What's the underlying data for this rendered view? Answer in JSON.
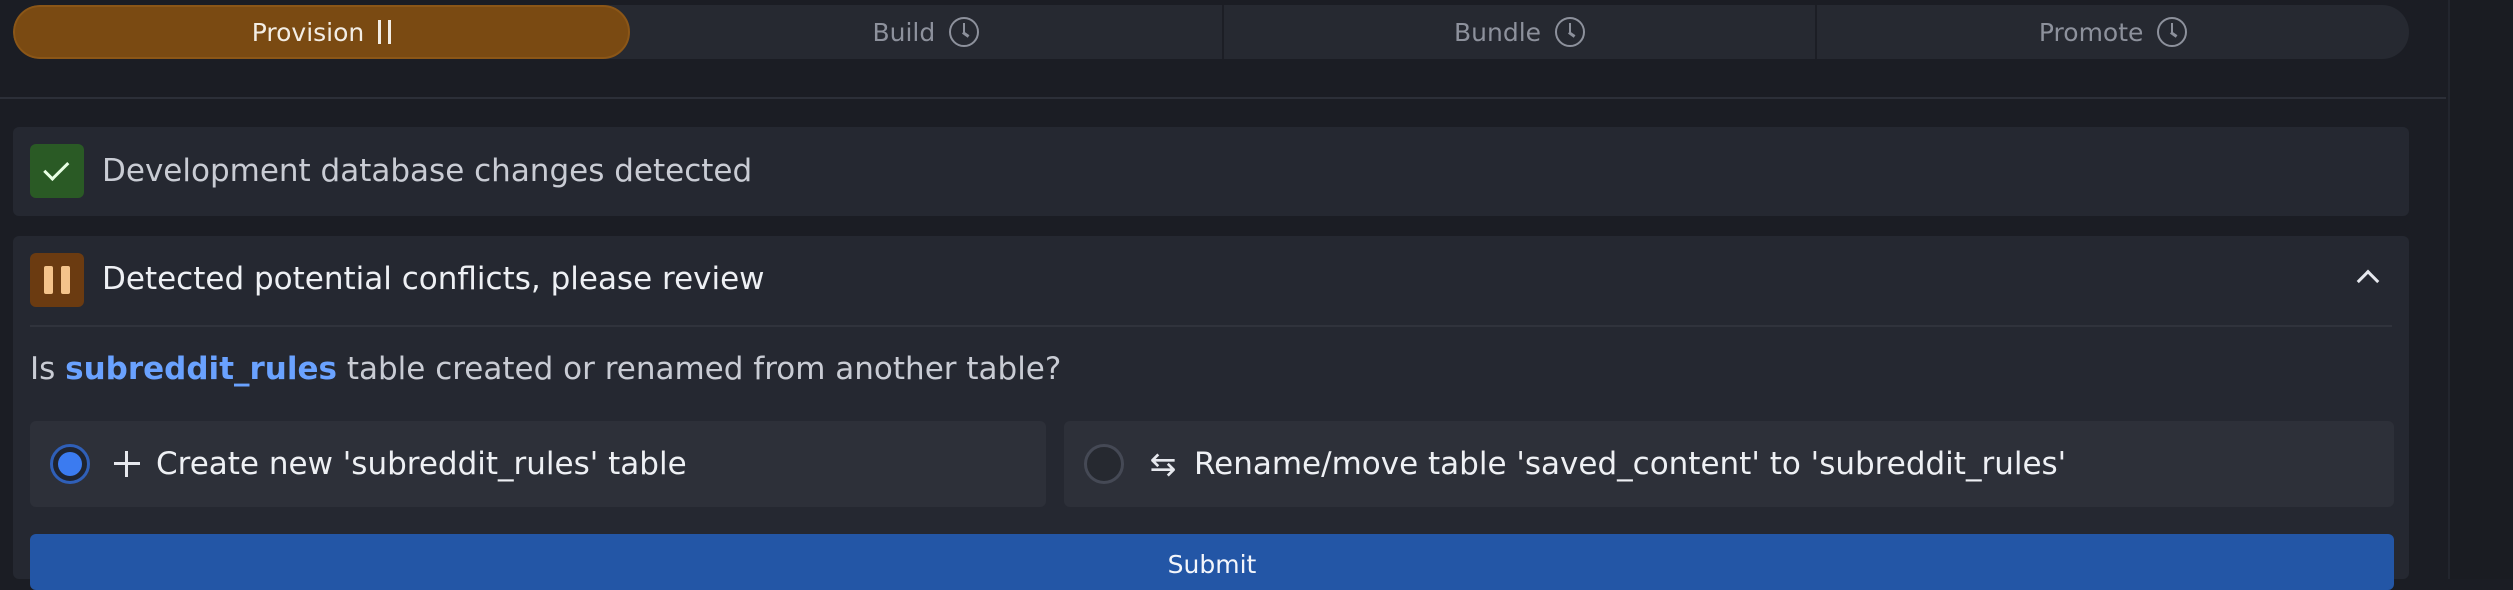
{
  "stepper": {
    "steps": [
      {
        "label": "Provision",
        "state": "active"
      },
      {
        "label": "Build",
        "state": "pending"
      },
      {
        "label": "Bundle",
        "state": "pending"
      },
      {
        "label": "Promote",
        "state": "pending"
      }
    ]
  },
  "status_cards": {
    "dev_changes": {
      "title": "Development database changes detected",
      "icon": "check-icon"
    },
    "conflicts": {
      "title": "Detected potential conflicts, please review",
      "icon": "pause-icon"
    }
  },
  "question": {
    "prefix": "Is",
    "table_name": "subreddit_rules",
    "suffix": "table created or renamed from another table?"
  },
  "options": [
    {
      "label": "Create new 'subreddit_rules' table",
      "icon": "plus-icon",
      "selected": true
    },
    {
      "label": "Rename/move table 'saved_content' to 'subreddit_rules'",
      "icon": "swap-arrows-icon",
      "selected": false
    }
  ],
  "submit_label": "Submit",
  "colors": {
    "active_step": "#7a4a12",
    "success": "#2a5a25",
    "warning": "#6b3b11",
    "accent": "#3b7bf0",
    "submit": "#2356a6"
  }
}
